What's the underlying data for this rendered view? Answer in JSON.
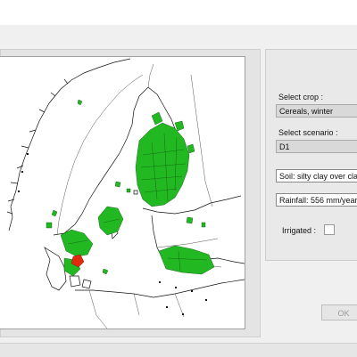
{
  "crop": {
    "label": "Select crop :",
    "value": "Cereals, winter"
  },
  "scenario": {
    "label": "Select scenario :",
    "value": "D1"
  },
  "soil": {
    "value": "Soil: silty clay over cla"
  },
  "rainfall": {
    "value": "Rainfall: 556 mm/year"
  },
  "irrigated": {
    "label": "Irrigated :",
    "checked": false
  },
  "ok_button": {
    "label": "OK",
    "enabled": false
  },
  "map": {
    "land_color": "#ffffff",
    "crop_area_color": "#22b822",
    "selected_area_color": "#e02a10"
  }
}
